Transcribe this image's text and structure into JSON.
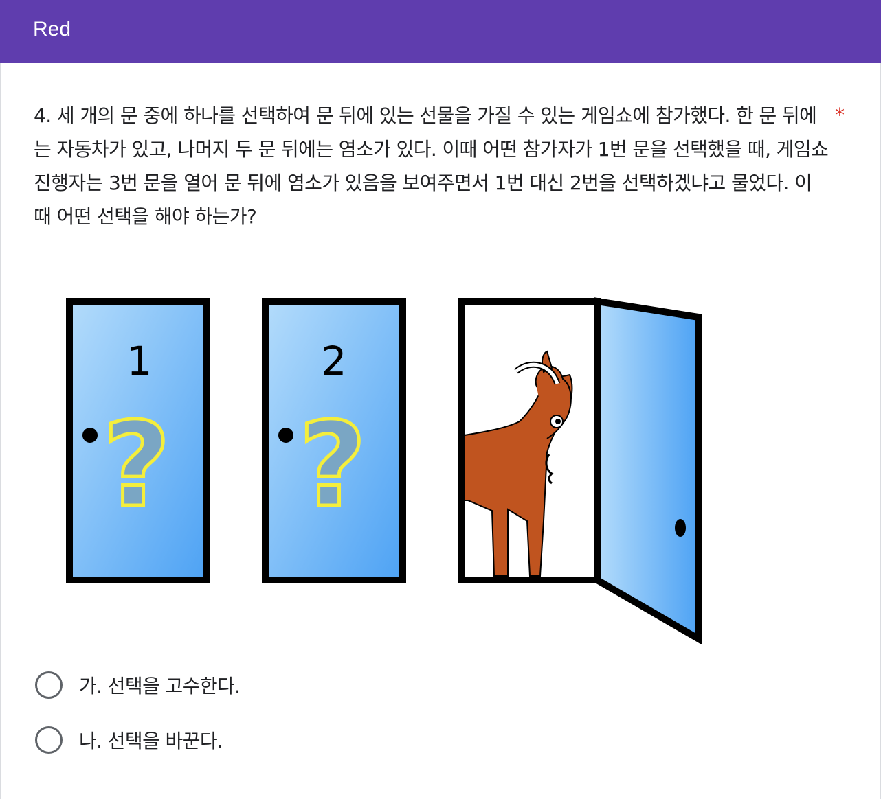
{
  "header": {
    "title": "Red"
  },
  "question": {
    "text": "4. 세 개의 문 중에 하나를 선택하여 문 뒤에 있는 선물을 가질 수 있는 게임쇼에 참가했다.  한 문 뒤에는 자동차가 있고, 나머지 두 문 뒤에는 염소가 있다. 이때 어떤 참가자가 1번 문을 선택했을 때, 게임쇼 진행자는 3번 문을 열어 문 뒤에 염소가 있음을 보여주면서 1번 대신 2번을 선택하겠냐고 물었다. 이 때 어떤 선택을 해야 하는가?",
    "required_mark": "*"
  },
  "illustration": {
    "door1_number": "1",
    "door2_number": "2",
    "question_mark": "?",
    "door_color": "#5aa8f5",
    "goat_color": "#c0541f",
    "question_mark_color": "#f4ee3c"
  },
  "options": [
    {
      "label": "가. 선택을 고수한다.",
      "selected": false
    },
    {
      "label": "나. 선택을 바꾼다.",
      "selected": false
    }
  ],
  "colors": {
    "header_bg": "#5f3dae",
    "required": "#d93025",
    "radio_border": "#5f6368"
  }
}
